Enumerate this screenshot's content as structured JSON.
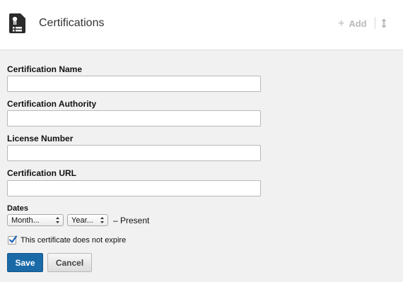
{
  "header": {
    "icon": "certificate-icon",
    "title": "Certifications",
    "add_label": "Add",
    "add_icon": "plus-icon",
    "reorder_icon": "reorder-arrows-icon"
  },
  "form": {
    "certification_name": {
      "label": "Certification Name",
      "value": ""
    },
    "certification_authority": {
      "label": "Certification Authority",
      "value": ""
    },
    "license_number": {
      "label": "License Number",
      "value": ""
    },
    "certification_url": {
      "label": "Certification URL",
      "value": ""
    },
    "dates": {
      "label": "Dates",
      "month_value": "Month...",
      "year_value": "Year...",
      "present_text": "– Present"
    },
    "no_expire": {
      "label": "This certificate does not expire",
      "checked": true
    }
  },
  "actions": {
    "save_label": "Save",
    "cancel_label": "Cancel"
  },
  "colors": {
    "save_bg": "#1b6aa8",
    "checkbox_check": "#1a5fb4"
  }
}
